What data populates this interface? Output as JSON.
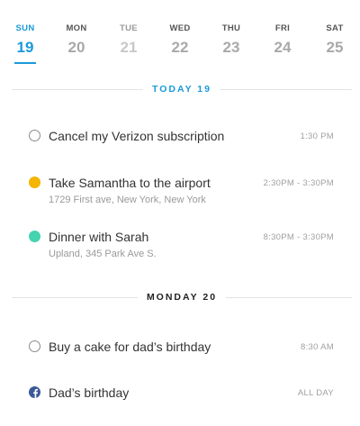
{
  "week": {
    "days": [
      {
        "dow": "SUN",
        "num": "19"
      },
      {
        "dow": "MON",
        "num": "20"
      },
      {
        "dow": "TUE",
        "num": "21"
      },
      {
        "dow": "WED",
        "num": "22"
      },
      {
        "dow": "THU",
        "num": "23"
      },
      {
        "dow": "FRI",
        "num": "24"
      },
      {
        "dow": "SAT",
        "num": "25"
      }
    ],
    "selected": "SUN"
  },
  "sections": [
    {
      "label": "TODAY 19",
      "events": [
        {
          "title": "Cancel my Verizon subscription",
          "subtitle": "",
          "time": "1:30 PM",
          "marker": "circle-outline-icon"
        },
        {
          "title": "Take Samantha to the airport",
          "subtitle": "1729 First ave, New York, New York",
          "time": "2:30PM - 3:30PM",
          "marker": "yellow-dot-icon"
        },
        {
          "title": "Dinner with Sarah",
          "subtitle": "Upland, 345 Park Ave S.",
          "time": "8:30PM - 3:30PM",
          "marker": "teal-dot-icon"
        }
      ]
    },
    {
      "label": "MONDAY 20",
      "events": [
        {
          "title": "Buy a cake for dad’s birthday",
          "subtitle": "",
          "time": "8:30 AM",
          "marker": "circle-outline-icon"
        },
        {
          "title": "Dad’s birthday",
          "subtitle": "",
          "time": "ALL DAY",
          "marker": "facebook-icon"
        }
      ]
    }
  ],
  "colors": {
    "accent": "#1a9ad9",
    "yellow": "#f4b400",
    "teal": "#46d3b0",
    "facebook": "#3b5998"
  }
}
